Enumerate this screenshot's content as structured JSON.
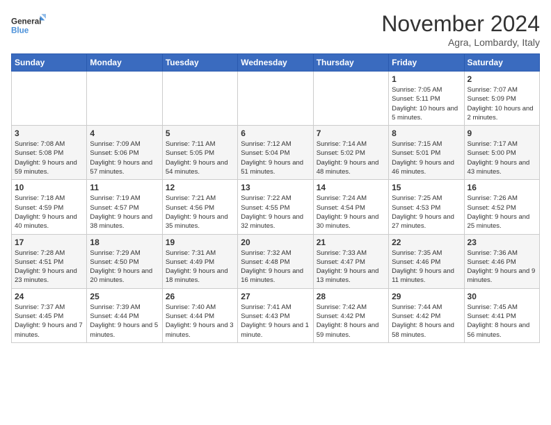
{
  "logo": {
    "line1": "General",
    "line2": "Blue"
  },
  "header": {
    "month_title": "November 2024",
    "location": "Agra, Lombardy, Italy"
  },
  "weekdays": [
    "Sunday",
    "Monday",
    "Tuesday",
    "Wednesday",
    "Thursday",
    "Friday",
    "Saturday"
  ],
  "weeks": [
    [
      {
        "day": "",
        "info": ""
      },
      {
        "day": "",
        "info": ""
      },
      {
        "day": "",
        "info": ""
      },
      {
        "day": "",
        "info": ""
      },
      {
        "day": "",
        "info": ""
      },
      {
        "day": "1",
        "info": "Sunrise: 7:05 AM\nSunset: 5:11 PM\nDaylight: 10 hours\nand 5 minutes."
      },
      {
        "day": "2",
        "info": "Sunrise: 7:07 AM\nSunset: 5:09 PM\nDaylight: 10 hours\nand 2 minutes."
      }
    ],
    [
      {
        "day": "3",
        "info": "Sunrise: 7:08 AM\nSunset: 5:08 PM\nDaylight: 9 hours\nand 59 minutes."
      },
      {
        "day": "4",
        "info": "Sunrise: 7:09 AM\nSunset: 5:06 PM\nDaylight: 9 hours\nand 57 minutes."
      },
      {
        "day": "5",
        "info": "Sunrise: 7:11 AM\nSunset: 5:05 PM\nDaylight: 9 hours\nand 54 minutes."
      },
      {
        "day": "6",
        "info": "Sunrise: 7:12 AM\nSunset: 5:04 PM\nDaylight: 9 hours\nand 51 minutes."
      },
      {
        "day": "7",
        "info": "Sunrise: 7:14 AM\nSunset: 5:02 PM\nDaylight: 9 hours\nand 48 minutes."
      },
      {
        "day": "8",
        "info": "Sunrise: 7:15 AM\nSunset: 5:01 PM\nDaylight: 9 hours\nand 46 minutes."
      },
      {
        "day": "9",
        "info": "Sunrise: 7:17 AM\nSunset: 5:00 PM\nDaylight: 9 hours\nand 43 minutes."
      }
    ],
    [
      {
        "day": "10",
        "info": "Sunrise: 7:18 AM\nSunset: 4:59 PM\nDaylight: 9 hours\nand 40 minutes."
      },
      {
        "day": "11",
        "info": "Sunrise: 7:19 AM\nSunset: 4:57 PM\nDaylight: 9 hours\nand 38 minutes."
      },
      {
        "day": "12",
        "info": "Sunrise: 7:21 AM\nSunset: 4:56 PM\nDaylight: 9 hours\nand 35 minutes."
      },
      {
        "day": "13",
        "info": "Sunrise: 7:22 AM\nSunset: 4:55 PM\nDaylight: 9 hours\nand 32 minutes."
      },
      {
        "day": "14",
        "info": "Sunrise: 7:24 AM\nSunset: 4:54 PM\nDaylight: 9 hours\nand 30 minutes."
      },
      {
        "day": "15",
        "info": "Sunrise: 7:25 AM\nSunset: 4:53 PM\nDaylight: 9 hours\nand 27 minutes."
      },
      {
        "day": "16",
        "info": "Sunrise: 7:26 AM\nSunset: 4:52 PM\nDaylight: 9 hours\nand 25 minutes."
      }
    ],
    [
      {
        "day": "17",
        "info": "Sunrise: 7:28 AM\nSunset: 4:51 PM\nDaylight: 9 hours\nand 23 minutes."
      },
      {
        "day": "18",
        "info": "Sunrise: 7:29 AM\nSunset: 4:50 PM\nDaylight: 9 hours\nand 20 minutes."
      },
      {
        "day": "19",
        "info": "Sunrise: 7:31 AM\nSunset: 4:49 PM\nDaylight: 9 hours\nand 18 minutes."
      },
      {
        "day": "20",
        "info": "Sunrise: 7:32 AM\nSunset: 4:48 PM\nDaylight: 9 hours\nand 16 minutes."
      },
      {
        "day": "21",
        "info": "Sunrise: 7:33 AM\nSunset: 4:47 PM\nDaylight: 9 hours\nand 13 minutes."
      },
      {
        "day": "22",
        "info": "Sunrise: 7:35 AM\nSunset: 4:46 PM\nDaylight: 9 hours\nand 11 minutes."
      },
      {
        "day": "23",
        "info": "Sunrise: 7:36 AM\nSunset: 4:46 PM\nDaylight: 9 hours\nand 9 minutes."
      }
    ],
    [
      {
        "day": "24",
        "info": "Sunrise: 7:37 AM\nSunset: 4:45 PM\nDaylight: 9 hours\nand 7 minutes."
      },
      {
        "day": "25",
        "info": "Sunrise: 7:39 AM\nSunset: 4:44 PM\nDaylight: 9 hours\nand 5 minutes."
      },
      {
        "day": "26",
        "info": "Sunrise: 7:40 AM\nSunset: 4:44 PM\nDaylight: 9 hours\nand 3 minutes."
      },
      {
        "day": "27",
        "info": "Sunrise: 7:41 AM\nSunset: 4:43 PM\nDaylight: 9 hours\nand 1 minute."
      },
      {
        "day": "28",
        "info": "Sunrise: 7:42 AM\nSunset: 4:42 PM\nDaylight: 8 hours\nand 59 minutes."
      },
      {
        "day": "29",
        "info": "Sunrise: 7:44 AM\nSunset: 4:42 PM\nDaylight: 8 hours\nand 58 minutes."
      },
      {
        "day": "30",
        "info": "Sunrise: 7:45 AM\nSunset: 4:41 PM\nDaylight: 8 hours\nand 56 minutes."
      }
    ]
  ]
}
